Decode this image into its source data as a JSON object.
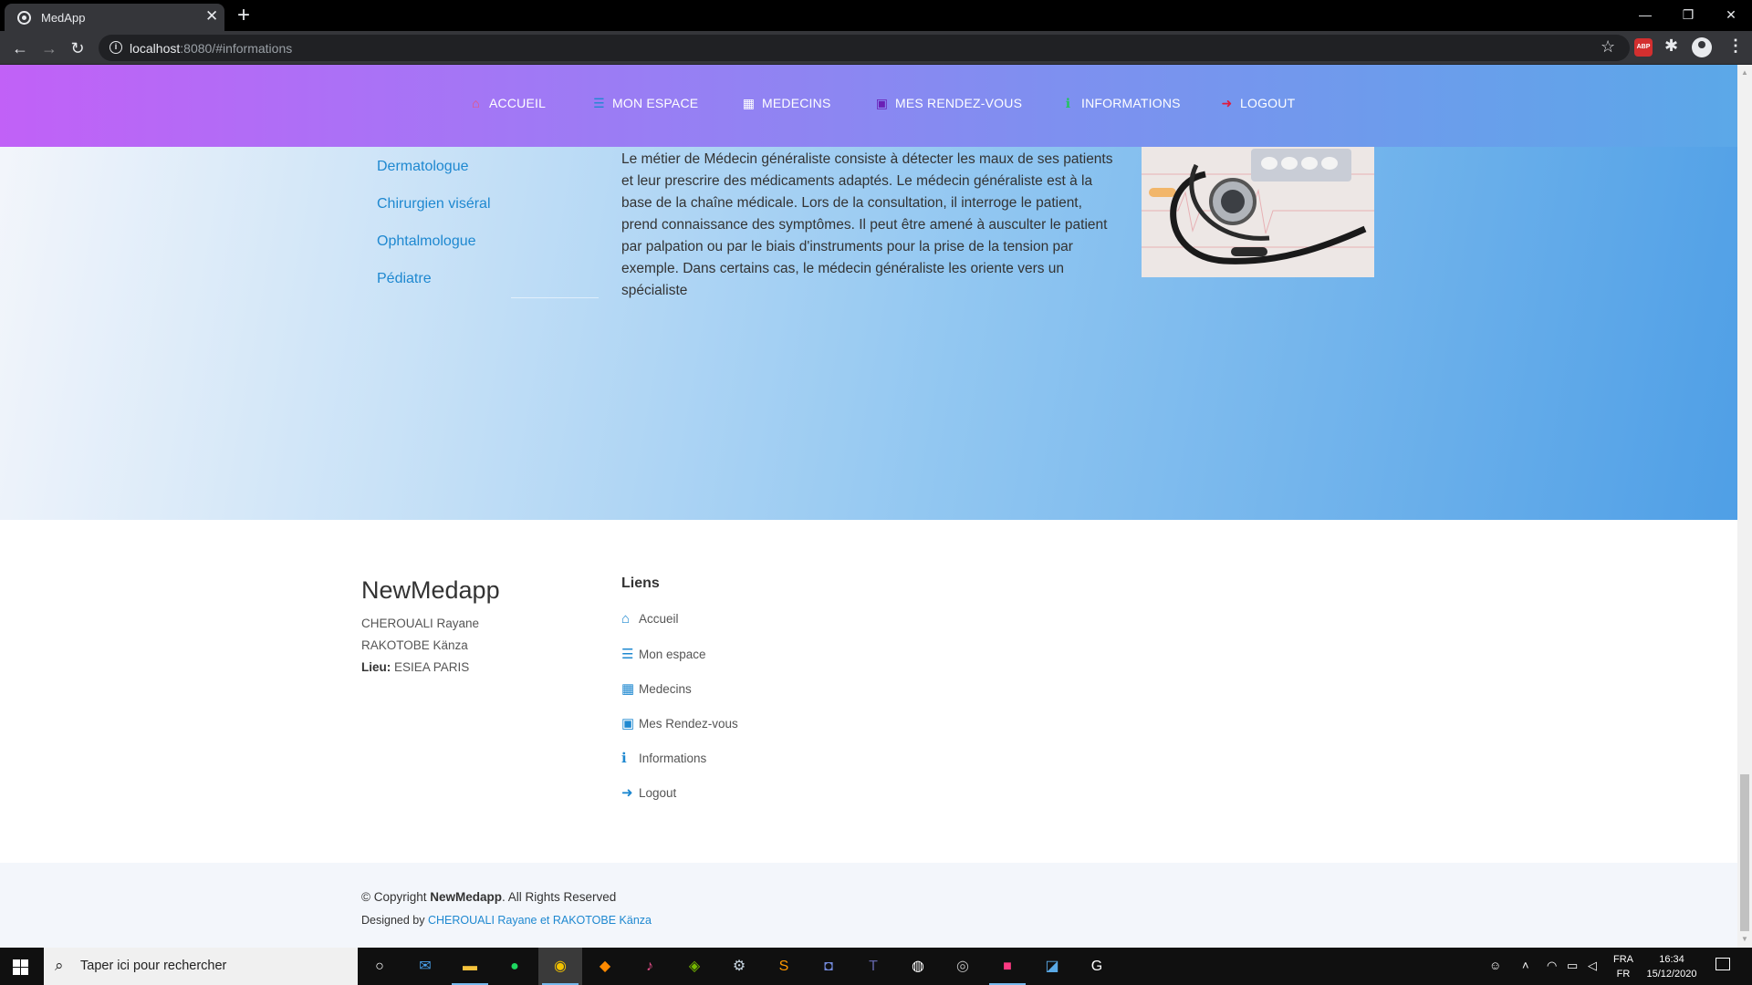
{
  "browser": {
    "tab_title": "MedApp",
    "tab_close": "✕",
    "new_tab": "+",
    "url_host": "localhost",
    "url_rest": ":8080/#informations",
    "abp_label": "ABP",
    "controls": {
      "minimize": "—",
      "restore": "❐",
      "close": "✕"
    }
  },
  "nav": {
    "items": [
      {
        "label": "ACCUEIL",
        "icon": "home-icon",
        "color": "#f0506e"
      },
      {
        "label": "MON ESPACE",
        "icon": "align-left-icon",
        "color": "#1e88d0"
      },
      {
        "label": "MEDECINS",
        "icon": "hospital-icon",
        "color": "#ffffff"
      },
      {
        "label": "MES RENDEZ-VOUS",
        "icon": "calendar-icon",
        "color": "#6a1fb5"
      },
      {
        "label": "INFORMATIONS",
        "icon": "info-icon",
        "color": "#22c55e"
      },
      {
        "label": "LOGOUT",
        "icon": "sign-out-icon",
        "color": "#e01b3c"
      }
    ]
  },
  "main": {
    "specialties": [
      "Dermatologue",
      "Chirurgien viséral",
      "Ophtalmologue",
      "Pédiatre"
    ],
    "description": "Le métier de Médecin généraliste consiste à détecter les maux de ses patients et leur prescrire des médicaments adaptés. Le médecin généraliste est à la base de la chaîne médicale. Lors de la consultation, il interroge le patient, prend connaissance des symptômes. Il peut être amené à ausculter le patient par palpation ou par le biais d'instruments pour la prise de la tension par exemple. Dans certains cas, le médecin généraliste les oriente vers un spécialiste"
  },
  "footer": {
    "brand": "NewMedapp",
    "names": [
      "CHEROUALI Rayane",
      "RAKOTOBE Känza"
    ],
    "lieu_label": "Lieu:",
    "lieu_value": "ESIEA PARIS",
    "links_title": "Liens",
    "links": [
      {
        "label": "Accueil",
        "icon": "home-icon"
      },
      {
        "label": "Mon espace",
        "icon": "align-left-icon"
      },
      {
        "label": "Medecins",
        "icon": "hospital-icon"
      },
      {
        "label": "Mes Rendez-vous",
        "icon": "calendar-icon"
      },
      {
        "label": "Informations",
        "icon": "info-icon"
      },
      {
        "label": "Logout",
        "icon": "sign-out-icon"
      }
    ],
    "copyright_prefix": "© Copyright",
    "copyright_brand": "NewMedapp",
    "copyright_suffix": ". All Rights Reserved",
    "designed_prefix": "Designed by",
    "designed_authors": "CHEROUALI Rayane et RAKOTOBE Känza"
  },
  "taskbar": {
    "search_placeholder": "Taper ici pour rechercher",
    "lang_top": "FRA",
    "lang_bottom": "FR",
    "time": "16:34",
    "date": "15/12/2020"
  },
  "colors": {
    "accent_link": "#1e88d0",
    "navbar_start": "#c161f7",
    "navbar_end": "#5ba8e8"
  }
}
